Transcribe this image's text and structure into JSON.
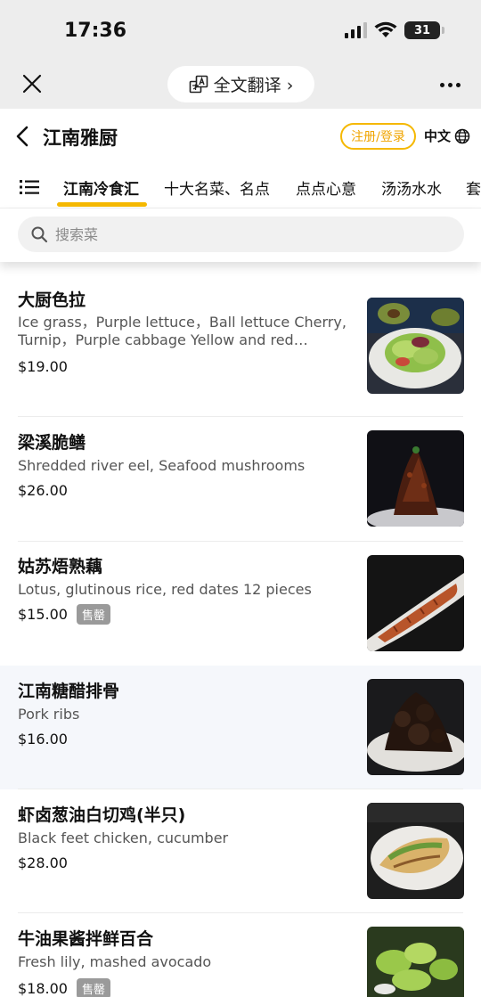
{
  "status": {
    "time": "17:36",
    "battery": "31"
  },
  "nav": {
    "translate_label": "全文翻译 ›"
  },
  "header": {
    "title": "江南雅厨",
    "login_label": "注册/登录",
    "lang_label": "中文"
  },
  "categories": [
    "江南冷食汇",
    "十大名菜、名点",
    "点点心意",
    "汤汤水水",
    "套"
  ],
  "search": {
    "placeholder": "搜索菜"
  },
  "dishes": [
    {
      "name": "大厨色拉",
      "desc": "Ice grass，Purple lettuce，Ball lettuce Cherry, Turnip，Purple cabbage Yellow and red pepper",
      "price": "$19.00",
      "badge": ""
    },
    {
      "name": "梁溪脆鳝",
      "desc": "Shredded river eel, Seafood mushrooms",
      "price": "$26.00",
      "badge": ""
    },
    {
      "name": "姑苏焐熟藕",
      "desc": "Lotus, glutinous rice, red dates 12 pieces",
      "price": "$15.00",
      "badge": "售罄"
    },
    {
      "name": "江南糖醋排骨",
      "desc": "Pork ribs",
      "price": "$16.00",
      "badge": ""
    },
    {
      "name": "虾卤葱油白切鸡(半只)",
      "desc": "Black feet chicken, cucumber",
      "price": "$28.00",
      "badge": ""
    },
    {
      "name": "牛油果酱拌鲜百合",
      "desc": "Fresh lily, mashed avocado",
      "price": "$18.00",
      "badge": "售罄"
    }
  ],
  "colors": {
    "accent": "#f5b800",
    "soldout": "#9a9a9a"
  }
}
